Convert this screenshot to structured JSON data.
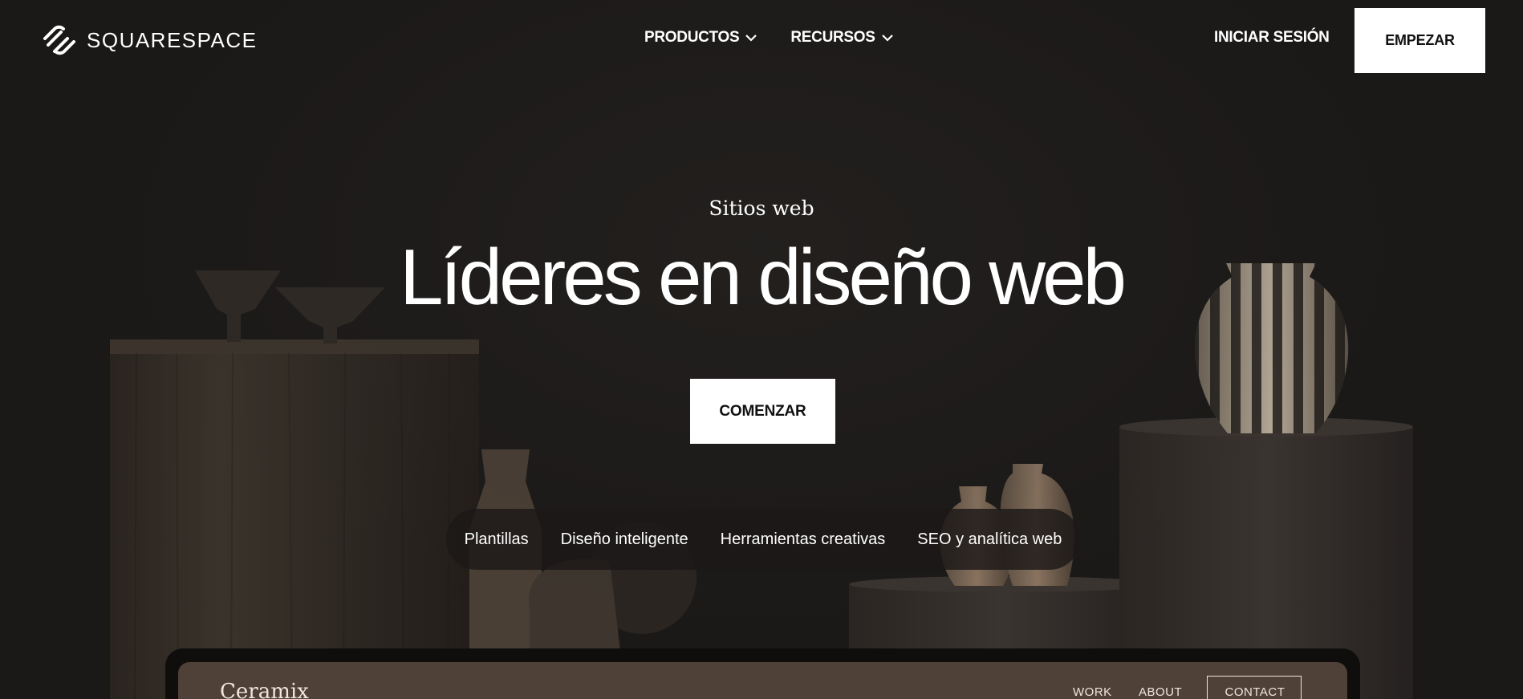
{
  "header": {
    "logo_text": "SQUARESPACE",
    "nav": [
      {
        "label": "PRODUCTOS",
        "icon": "chevron-down-icon"
      },
      {
        "label": "RECURSOS",
        "icon": "chevron-down-icon"
      }
    ],
    "signin_label": "INICIAR SESIÓN",
    "start_label": "EMPEZAR"
  },
  "hero": {
    "eyebrow": "Sitios web",
    "headline": "Líderes en diseño web",
    "cta_label": "COMENZAR",
    "pills": [
      "Plantillas",
      "Diseño inteligente",
      "Herramientas creativas",
      "SEO y analítica web"
    ]
  },
  "preview": {
    "brand": "Ceramix",
    "nav": [
      "WORK",
      "ABOUT"
    ],
    "contact_label": "CONTACT"
  },
  "colors": {
    "background": "#1b1918",
    "button": "#ffffff",
    "preview_bg": "#4f4038"
  }
}
